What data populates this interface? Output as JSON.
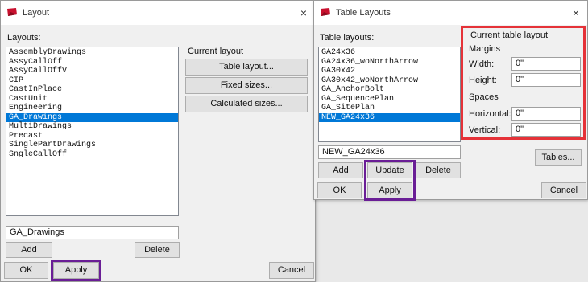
{
  "layout_dialog": {
    "title": "Layout",
    "close_glyph": "×",
    "layouts_label": "Layouts:",
    "layouts": [
      "AssemblyDrawings",
      "AssyCallOff",
      "AssyCallOffV",
      "CIP",
      "CastInPlace",
      "CastUnit",
      "Engineering",
      "GA_Drawings",
      "MultiDrawings",
      "Precast",
      "SinglePartDrawings",
      "SngleCallOff"
    ],
    "selected_index": 7,
    "current_layout_label": "Current layout",
    "table_layout_button": "Table layout...",
    "fixed_sizes_button": "Fixed sizes...",
    "calculated_sizes_button": "Calculated sizes...",
    "name_value": "GA_Drawings",
    "add_button": "Add",
    "delete_button": "Delete",
    "ok_button": "OK",
    "apply_button": "Apply",
    "cancel_button": "Cancel"
  },
  "table_layouts_dialog": {
    "title": "Table Layouts",
    "close_glyph": "×",
    "table_layouts_label": "Table layouts:",
    "table_layouts": [
      "GA24x36",
      "GA24x36_woNorthArrow",
      "GA30x42",
      "GA30x42_woNorthArrow",
      "GA_AnchorBolt",
      "GA_SequencePlan",
      "GA_SitePlan",
      "NEW_GA24x36"
    ],
    "selected_index": 7,
    "name_value": "NEW_GA24x36",
    "add_button": "Add",
    "update_button": "Update",
    "delete_button": "Delete",
    "ok_button": "OK",
    "apply_button": "Apply",
    "cancel_button": "Cancel",
    "current_table_layout_label": "Current table layout",
    "margins_label": "Margins",
    "width_label": "Width:",
    "width_value": "0\"",
    "height_label": "Height:",
    "height_value": "0\"",
    "spaces_label": "Spaces",
    "horizontal_label": "Horizontal:",
    "horizontal_value": "0\"",
    "vertical_label": "Vertical:",
    "vertical_value": "0\"",
    "tables_button": "Tables..."
  },
  "colors": {
    "selection": "#0078d7",
    "purple_highlight": "#6a1e96",
    "red_highlight": "#e53238",
    "app_icon_red": "#c8102e"
  }
}
